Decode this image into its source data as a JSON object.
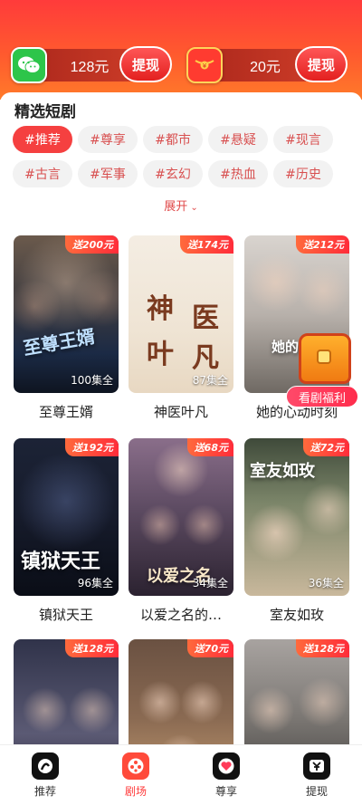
{
  "wallet": {
    "cash_amount": "128元",
    "cash_button": "提现",
    "coin_amount": "20元",
    "coin_button": "提现",
    "coin_icon": "¥"
  },
  "section": {
    "title": "精选短剧"
  },
  "tags": [
    "#推荐",
    "#尊享",
    "#都市",
    "#悬疑",
    "#现言",
    "#古言",
    "#军事",
    "#玄幻",
    "#热血",
    "#历史"
  ],
  "expand_label": "展开",
  "cards": [
    {
      "title": "至尊王婿",
      "badge": "送200元",
      "eps": "100集全",
      "art": "至尊王婿"
    },
    {
      "title": "神医叶凡",
      "badge": "送174元",
      "eps": "87集全",
      "art1": "神",
      "art2": "医",
      "art3": "叶",
      "art4": "凡"
    },
    {
      "title": "她的心动时刻",
      "badge": "送212元",
      "eps": "",
      "art": "她的心动"
    },
    {
      "title": "镇狱天王",
      "badge": "送192元",
      "eps": "96集全",
      "art": "镇狱天王"
    },
    {
      "title": "以爱之名的…",
      "badge": "送68元",
      "eps": "34集全",
      "art": "以爱之名"
    },
    {
      "title": "室友如玫",
      "badge": "送72元",
      "eps": "36集全",
      "art": "室友如玫"
    },
    {
      "title": "",
      "badge": "送128元",
      "eps": ""
    },
    {
      "title": "",
      "badge": "送70元",
      "eps": ""
    },
    {
      "title": "",
      "badge": "送128元",
      "eps": ""
    }
  ],
  "gift": {
    "label": "看剧福利"
  },
  "tabbar": [
    {
      "label": "推荐",
      "icon": "recommend-icon"
    },
    {
      "label": "剧场",
      "icon": "theater-icon"
    },
    {
      "label": "尊享",
      "icon": "heart-icon"
    },
    {
      "label": "提现",
      "icon": "withdraw-icon"
    }
  ]
}
